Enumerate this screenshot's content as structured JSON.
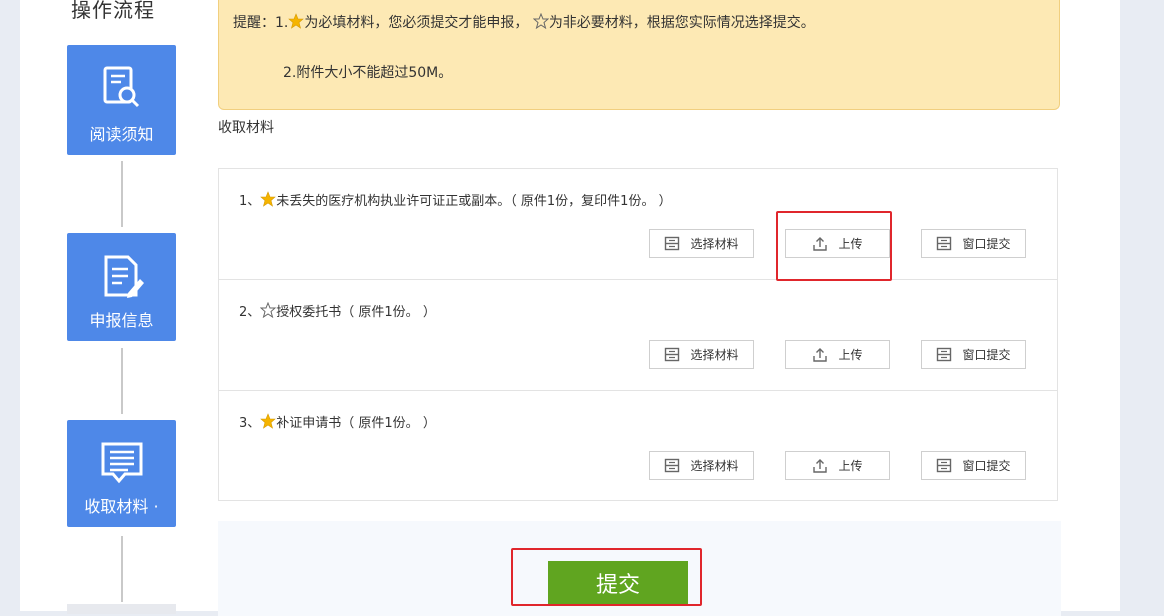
{
  "sidebar": {
    "title": "操作流程",
    "steps": [
      {
        "label": "阅读须知",
        "icon": "document-search-icon"
      },
      {
        "label": "申报信息",
        "icon": "document-edit-icon"
      },
      {
        "label": "收取材料 ·",
        "icon": "message-list-icon"
      }
    ]
  },
  "notice": {
    "line1_prefix": "提醒：1.",
    "line1_required": "为必填材料，您必须提交才能申报，",
    "line1_optional": "为非必要材料，根据您实际情况选择提交。",
    "line2": "2.附件大小不能超过50M。"
  },
  "section_title": "收取材料",
  "materials": [
    {
      "index": "1、",
      "required": true,
      "text": "未丢失的医疗机构执业许可证正或副本。（ 原件1份，复印件1份。 ）"
    },
    {
      "index": "2、",
      "required": false,
      "text": "授权委托书（ 原件1份。 ）"
    },
    {
      "index": "3、",
      "required": true,
      "text": "补证申请书（ 原件1份。 ）"
    }
  ],
  "buttons": {
    "select": "选择材料",
    "upload": "上传",
    "window": "窗口提交"
  },
  "submit_label": "提交",
  "colors": {
    "step_bg": "#4e88e8",
    "submit_bg": "#60a520",
    "highlight": "#e0262c",
    "notice_bg": "#fde9b4"
  }
}
